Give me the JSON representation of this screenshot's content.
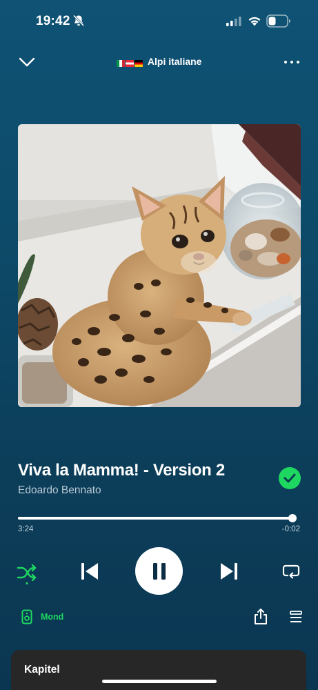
{
  "status_bar": {
    "time": "19:42"
  },
  "header": {
    "playlist_title": "Alpi italiane",
    "flag_icons": [
      "italy-flag-icon",
      "austria-flag-icon",
      "germany-flag-icon"
    ]
  },
  "artwork": {
    "icon": "album-artwork-kitten"
  },
  "track": {
    "title": "Viva la Mamma! - Version 2",
    "artist": "Edoardo Bennato",
    "saved": true
  },
  "progress": {
    "elapsed": "3:24",
    "remaining": "-0:02",
    "fraction": 0.99
  },
  "device": {
    "label": "Mond"
  },
  "chapters": {
    "title": "Kapitel"
  },
  "colors": {
    "accent": "#1ed760",
    "background_top": "#0f5274",
    "background_bottom": "#0b3651",
    "card": "#272727"
  }
}
